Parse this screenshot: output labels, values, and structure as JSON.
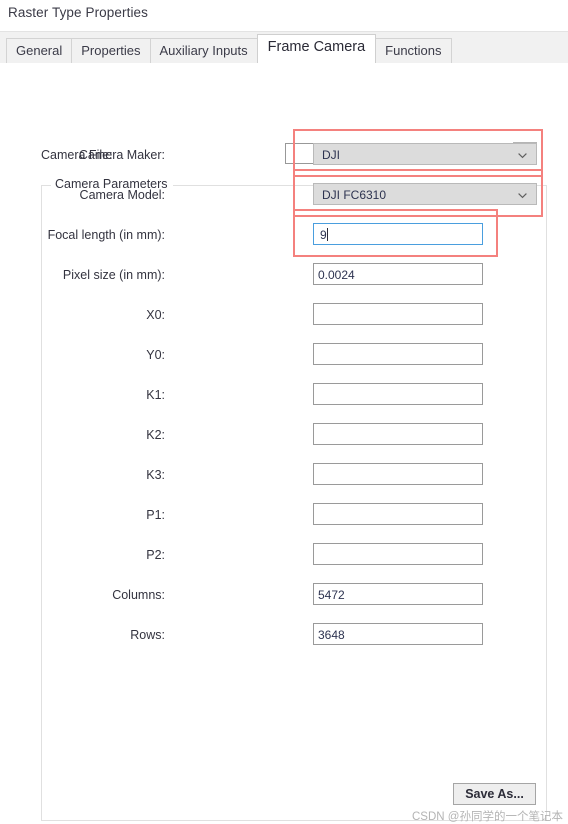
{
  "window": {
    "title": "Raster Type Properties"
  },
  "tabs": [
    {
      "label": "General",
      "active": false
    },
    {
      "label": "Properties",
      "active": false
    },
    {
      "label": "Auxiliary Inputs",
      "active": false
    },
    {
      "label": "Frame Camera",
      "active": true
    },
    {
      "label": "Functions",
      "active": false
    }
  ],
  "camera_file": {
    "label": "Camera File:",
    "value": "",
    "browse_icon": "open-folder-icon"
  },
  "group": {
    "title": "Camera Parameters"
  },
  "fields": [
    {
      "label": "Camera Maker:",
      "value": "DJI",
      "type": "combo",
      "highlighted": true
    },
    {
      "label": "Camera Model:",
      "value": "DJI FC6310",
      "type": "combo",
      "highlighted": true
    },
    {
      "label": "Focal length (in mm):",
      "value": "9",
      "type": "text-focus",
      "highlighted": true
    },
    {
      "label": "Pixel size (in mm):",
      "value": "0.0024",
      "type": "text",
      "highlighted": false
    },
    {
      "label": "X0:",
      "value": "",
      "type": "text",
      "highlighted": false
    },
    {
      "label": "Y0:",
      "value": "",
      "type": "text",
      "highlighted": false
    },
    {
      "label": "K1:",
      "value": "",
      "type": "text",
      "highlighted": false
    },
    {
      "label": "K2:",
      "value": "",
      "type": "text",
      "highlighted": false
    },
    {
      "label": "K3:",
      "value": "",
      "type": "text",
      "highlighted": false
    },
    {
      "label": "P1:",
      "value": "",
      "type": "text",
      "highlighted": false
    },
    {
      "label": "P2:",
      "value": "",
      "type": "text",
      "highlighted": false
    },
    {
      "label": "Columns:",
      "value": "5472",
      "type": "text",
      "highlighted": false
    },
    {
      "label": "Rows:",
      "value": "3648",
      "type": "text",
      "highlighted": false
    }
  ],
  "footer": {
    "save_as_label": "Save As...",
    "watermark": "CSDN @孙同学的一个笔记本"
  },
  "colors": {
    "highlight": "#f4817e",
    "focus_border": "#4a9ede",
    "combo_bg": "#dcdcdc",
    "panel_bg": "#ffffff",
    "tabstrip_bg": "#f1f1f1"
  }
}
